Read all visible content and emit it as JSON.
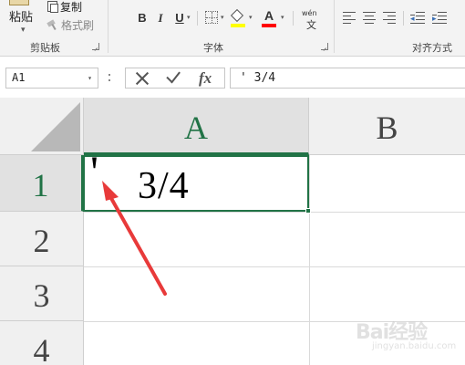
{
  "ribbon": {
    "clipboard": {
      "paste_label": "粘贴",
      "copy_label": "复制",
      "format_painter_label": "格式刷",
      "group_label": "剪贴板"
    },
    "font": {
      "bold_label": "B",
      "italic_label": "I",
      "underline_label": "U",
      "font_color_letter": "A",
      "phonetic_top": "wén",
      "phonetic_bottom": "文",
      "group_label": "字体",
      "fill_color": "#ffff00",
      "font_color": "#ff0000"
    },
    "alignment": {
      "group_label": "对齐方式"
    }
  },
  "formula_bar": {
    "name_box": "A1",
    "fx_label": "fx",
    "content": "' 3/4"
  },
  "grid": {
    "columns": [
      "A",
      "B"
    ],
    "rows": [
      "1",
      "2",
      "3",
      "4"
    ],
    "cell_a1": {
      "apostrophe": "'",
      "value": "3/4"
    },
    "accent_color": "#217346",
    "annotation_arrow_color": "#e83a3a"
  },
  "watermark": {
    "text": "Bai经验",
    "sub": "jingyan.baidu.com"
  },
  "icons": [
    "clipboard-icon",
    "copy-icon",
    "format-painter-icon",
    "borders-icon",
    "fill-color-icon",
    "font-color-icon",
    "phonetic-guide-icon",
    "align-left-icon",
    "align-center-icon",
    "align-right-icon",
    "decrease-indent-icon",
    "increase-indent-icon",
    "cancel-icon",
    "enter-icon",
    "function-icon",
    "select-all-icon"
  ]
}
